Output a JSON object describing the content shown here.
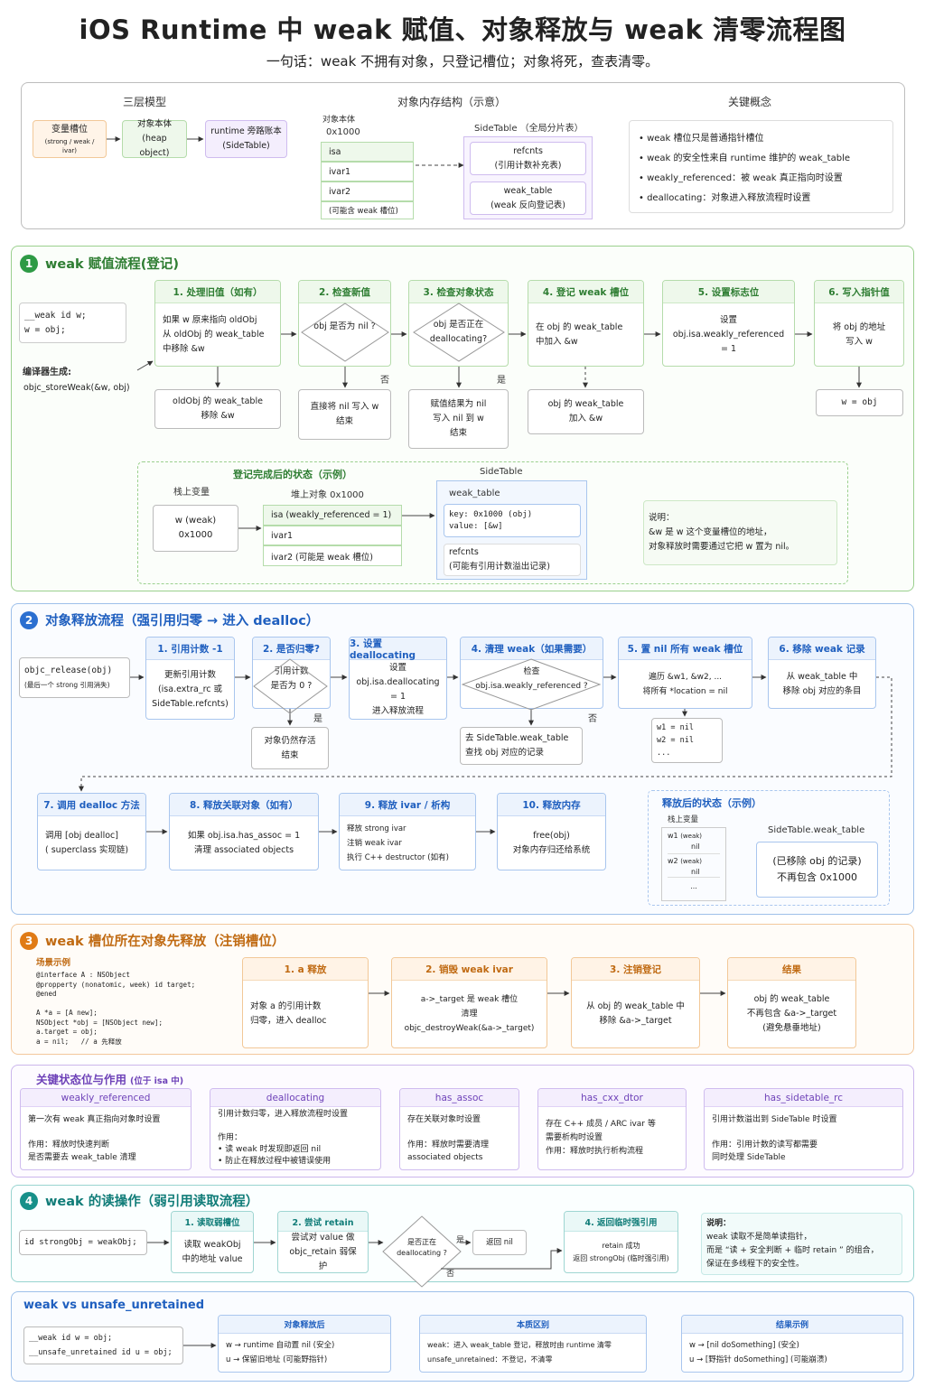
{
  "header": {
    "title": "iOS Runtime 中 weak 赋值、对象释放与 weak 清零流程图",
    "subtitle": "一句话：weak 不拥有对象，只登记槽位；对象将死，查表清零。"
  },
  "overview": {
    "model_title": "三层模型",
    "model": [
      {
        "title": "变量槽位",
        "sub": "(strong / weak / ivar)"
      },
      {
        "title": "对象本体",
        "sub": "(heap object)"
      },
      {
        "title": "runtime 旁路账本",
        "sub": "(SideTable)"
      }
    ],
    "mem_title": "对象内存结构（示意）",
    "obj_label": "对象本体",
    "obj_addr": "0x1000",
    "obj_fields": [
      "isa",
      "ivar1",
      "ivar2",
      "(可能含 weak 槽位)"
    ],
    "side_title": "SideTable （全局分片表）",
    "side_fields": [
      {
        "a": "refcnts",
        "b": "(引用计数补充表)"
      },
      {
        "a": "weak_table",
        "b": "(weak 反向登记表)"
      }
    ],
    "concept_title": "关键概念",
    "concepts": [
      "weak 槽位只是普通指针槽位",
      "weak 的安全性来自 runtime 维护的 weak_table",
      "weakly_referenced：被 weak 真正指向时设置",
      "deallocating：对象进入释放流程时设置"
    ]
  },
  "s1": {
    "num": "1",
    "title": "weak 赋值流程(登记)",
    "code": "__weak id w;\nw = obj;",
    "compiler_label": "编译器生成:",
    "compiler_call": "objc_storeWeak(&w, obj)",
    "steps": [
      {
        "h": "1. 处理旧值（如有）",
        "b": "如果 w 原来指向 oldObj\n从 oldObj 的 weak_table\n中移除 &w"
      },
      {
        "h": "2. 检查新值",
        "b": "obj 是否为 nil ?"
      },
      {
        "h": "3. 检查对象状态",
        "b": "obj 是否正在\ndeallocating?"
      },
      {
        "h": "4. 登记 weak 槽位",
        "b": "在 obj 的 weak_table\n中加入 &w"
      },
      {
        "h": "5. 设置标志位",
        "b": "设置\nobj.isa.weakly_referenced = 1"
      },
      {
        "h": "6. 写入指针值",
        "b": "将 obj 的地址\n写入 w"
      }
    ],
    "sub_old": "oldObj 的 weak_table\n移除 &w",
    "sub_nil": "直接将 nil 写入 w\n结束",
    "sub_dealloc": "赋值结果为 nil\n写入 nil 到 w\n结束",
    "sub_add": "obj 的 weak_table\n加入 &w",
    "sub_write": "w = obj",
    "no": "否",
    "yes": "是",
    "state_title": "登记完成后的状态（示例）",
    "stack_label": "栈上变量",
    "stack_var": "w (weak)\n0x1000",
    "heap_label": "堆上对象 0x1000",
    "heap_fields": [
      "isa (weakly_referenced = 1)",
      "ivar1",
      "ivar2 (可能是 weak 槽位)"
    ],
    "side_label": "SideTable",
    "wt_label": "weak_table",
    "wt_entry": "key: 0x1000 (obj)\n  value: [&w]",
    "rc_label": "refcnts",
    "rc_note": "(可能有引用计数溢出记录)",
    "note_title": "说明：",
    "note": "&w 是 w 这个变量槽位的地址，\n对象释放时需要通过它把 w 置为 nil。"
  },
  "s2": {
    "num": "2",
    "title": "对象释放流程（强引用归零 → 进入 dealloc）",
    "start": "objc_release(obj)",
    "start_sub": "(最后一个 strong 引用消失)",
    "steps": [
      {
        "h": "1. 引用计数 -1",
        "b": "更新引用计数\n(isa.extra_rc 或\nSideTable.refcnts)"
      },
      {
        "h": "2. 是否归零?",
        "b": "引用计数\n是否为 0 ?"
      },
      {
        "h": "3. 设置 deallocating",
        "b": "设置\nobj.isa.deallocating = 1\n进入释放流程"
      },
      {
        "h": "4. 清理 weak（如果需要）",
        "b": "检查\nobj.isa.weakly_referenced ?"
      },
      {
        "h": "5. 置 nil 所有 weak 槽位",
        "b": "遍历  &w1, &w2, ...\n将所有 *location = nil"
      },
      {
        "h": "6. 移除 weak 记录",
        "b": "从 weak_table 中\n移除 obj 对应的条目"
      }
    ],
    "alive": "对象仍然存活\n结束",
    "lookup": "去 SideTable.weak_table\n查找 obj 对应的记录",
    "nil_list": "w1 = nil\nw2 = nil\n...",
    "yes": "是",
    "no": "否",
    "steps2": [
      {
        "h": "7. 调用 dealloc 方法",
        "b": "调用 [obj dealloc]\n( superclass 实现链)"
      },
      {
        "h": "8. 释放关联对象（如有）",
        "b": "如果 obj.isa.has_assoc = 1\n清理 associated objects"
      },
      {
        "h": "9. 释放 ivar / 析构",
        "b": "释放 strong ivar\n注销 weak ivar\n执行 C++ destructor (如有)"
      },
      {
        "h": "10. 释放内存",
        "b": "free(obj)\n对象内存归还给系统"
      }
    ],
    "after_title": "释放后的状态（示例）",
    "after_stack": "栈上变量",
    "after_vars": [
      {
        "n": "w1",
        "t": "(weak)",
        "v": "nil"
      },
      {
        "n": "w2",
        "t": "(weak)",
        "v": "nil"
      }
    ],
    "after_more": "...",
    "after_side": "SideTable.weak_table",
    "after_side_box": "(已移除 obj 的记录)\n不再包含 0x1000"
  },
  "s3": {
    "num": "3",
    "title": "weak 槽位所在对象先释放（注销槽位）",
    "scene": "场景示例",
    "code": "@interface A : NSObject\n@propperty (nonatomic, week) id target;\n@ened\n\nA *a = [A new];\nNSObject *obj = [NSObject new];\na.target = obj;\na = nil;   // a 先释放",
    "steps": [
      {
        "h": "1. a 释放",
        "b": "对象 a 的引用计数\n归零，进入 dealloc"
      },
      {
        "h": "2. 销毁 weak ivar",
        "b": "a->_target 是 weak 槽位\n清理\nobjc_destroyWeak(&a->_target)"
      },
      {
        "h": "3. 注销登记",
        "b": "从 obj 的 weak_table 中\n移除 &a->_target"
      },
      {
        "h": "结果",
        "b": "obj 的 weak_table\n不再包含 &a->_target\n(避免悬垂地址)"
      }
    ]
  },
  "s_flags": {
    "title": "关键状态位与作用",
    "title_sub": "(位于 isa 中)",
    "cards": [
      {
        "h": "weakly_referenced",
        "b": "第一次有 weak 真正指向对象时设置\n\n作用：释放时快速判断\n是否需要去 weak_table 清理"
      },
      {
        "h": "deallocating",
        "b": "引用计数归零，进入释放流程时设置\n\n作用：\n• 读 weak 时发现即返回 nil\n• 防止在释放过程中被错误使用"
      },
      {
        "h": "has_assoc",
        "b": "存在关联对象时设置\n\n作用：释放时需要清理\nassociated objects"
      },
      {
        "h": "has_cxx_dtor",
        "b": "存在 C++ 成员 / ARC ivar 等\n需要析构时设置\n作用：释放时执行析构流程"
      },
      {
        "h": "has_sidetable_rc",
        "b": "引用计数溢出到 SideTable 时设置\n\n作用：引用计数的读写都需要\n同时处理 SideTable"
      }
    ]
  },
  "s4": {
    "num": "4",
    "title": "weak 的读操作（弱引用读取流程）",
    "code": "id strongObj = weakObj;",
    "steps": [
      {
        "h": "1. 读取弱槽位",
        "b": "读取 weakObj\n中的地址 value"
      },
      {
        "h": "2. 尝试 retain",
        "b": "尝试对 value 做\nobjc_retain 弱保护"
      },
      {
        "h": "4. 返回临时强引用",
        "b": "retain 成功\n返回 strongObj (临时强引用)"
      }
    ],
    "decision": "是否正在\ndeallocating ?",
    "ret_nil": "返回 nil",
    "yes": "是",
    "no": "否",
    "note_title": "说明：",
    "note": "weak 读取不是简单读指针，\n而是 “读 + 安全判断 + 临时 retain ” 的组合，\n保证在多线程下的安全性。"
  },
  "s5": {
    "title": "weak vs unsafe_unretained",
    "code": "__weak id w = obj;\n__unsafe_unretained id u = obj;",
    "cards": [
      {
        "h": "对象释放后",
        "b": "w  →  runtime 自动置 nil (安全)\nu  →  保留旧地址 (可能野指针)"
      },
      {
        "h": "本质区别",
        "b": "weak：进入 weak_table 登记，释放时由 runtime 清零\nunsafe_unretained：不登记，不清零"
      },
      {
        "h": "结果示例",
        "b": "w  →  [nil doSomething]  (安全)\nu  →  [野指针 doSomething]  (可能崩溃)"
      }
    ]
  },
  "colors": {
    "green": "#2e7d32",
    "blue": "#1f5fbf",
    "orange": "#e07b16",
    "purple": "#6e42b8",
    "teal": "#107c78"
  }
}
